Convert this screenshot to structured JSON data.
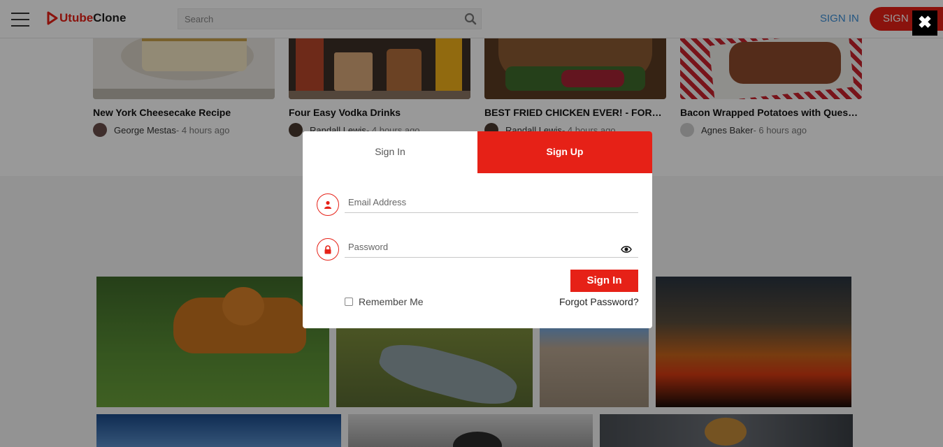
{
  "header": {
    "logo_part1": "Utube",
    "logo_part2": "Clone",
    "search_placeholder": "Search",
    "signin_label": "SIGN IN",
    "signup_label": "SIGN UP"
  },
  "videos": [
    {
      "title": "New York Cheesecake Recipe",
      "author": "George Mestas",
      "time": " - 4 hours ago"
    },
    {
      "title": "Four Easy Vodka Drinks",
      "author": "Randall Lewis",
      "time": " - 4 hours ago"
    },
    {
      "title": "BEST FRIED CHICKEN EVER! - FOREST ...",
      "author": "Randall Lewis",
      "time": " - 4 hours ago"
    },
    {
      "title": "Bacon Wrapped Potatoes with Queso Bl...",
      "author": "Agnes Baker",
      "time": " - 6 hours ago"
    }
  ],
  "modal": {
    "tab_signin": "Sign In",
    "tab_signup": "Sign Up",
    "email_placeholder": "Email Address",
    "password_placeholder": "Password",
    "signin_button": "Sign In",
    "remember_label": "Remember Me",
    "forgot_label": "Forgot Password?"
  },
  "colors": {
    "accent": "#e62117",
    "link": "#3b8fd9"
  },
  "icons": {
    "close": "close-icon",
    "menu": "hamburger-icon",
    "search": "search-icon",
    "user": "user-icon",
    "lock": "lock-icon",
    "eye": "eye-icon"
  }
}
